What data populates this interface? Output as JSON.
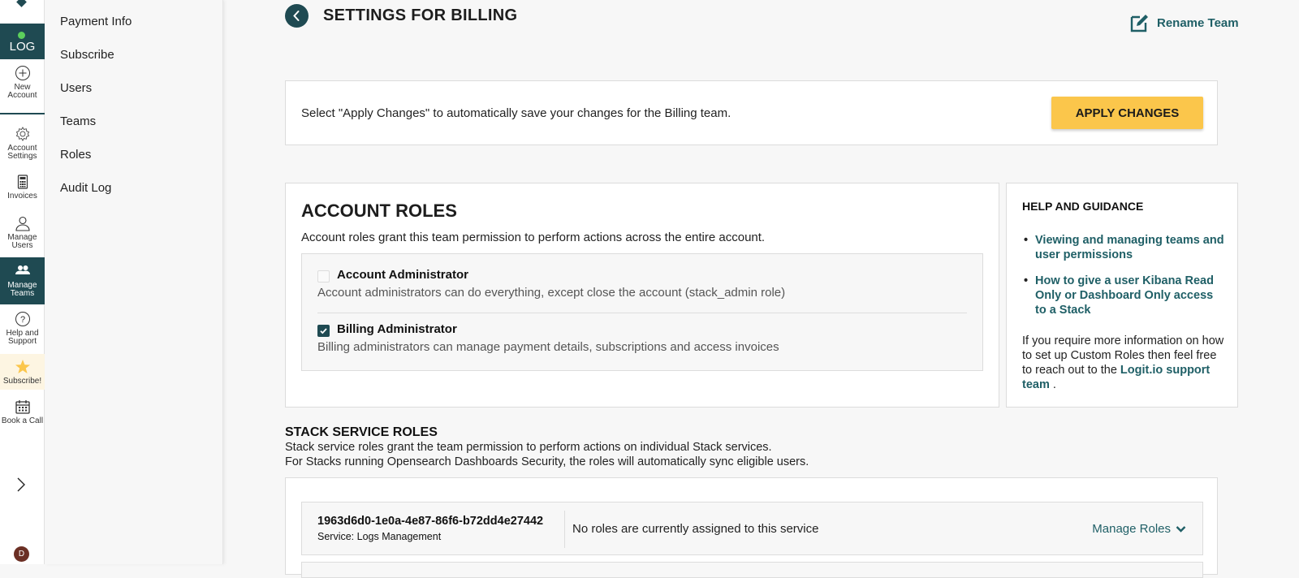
{
  "rail": {
    "brand_label": "LOG",
    "items": [
      {
        "label_l1": "New",
        "label_l2": "Account",
        "icon": "plus-circle-icon"
      },
      {
        "label_l1": "Account",
        "label_l2": "Settings",
        "icon": "gear-icon"
      },
      {
        "label_l1": "Invoices",
        "label_l2": "",
        "icon": "calculator-icon"
      },
      {
        "label_l1": "Manage",
        "label_l2": "Users",
        "icon": "user-icon"
      },
      {
        "label_l1": "Manage",
        "label_l2": "Teams",
        "icon": "users-icon"
      },
      {
        "label_l1": "Help and",
        "label_l2": "Support",
        "icon": "question-circle-icon"
      },
      {
        "label_l1": "Subscribe!",
        "label_l2": "",
        "icon": "star-icon"
      },
      {
        "label_l1": "Book a Call",
        "label_l2": "",
        "icon": "calendar-icon"
      }
    ],
    "avatar_initial": "D",
    "colors": {
      "brand": "#1f4a52",
      "status_dot": "#5ccf5c",
      "subscribe_bg": "#fdf5e2",
      "star": "#fbc64b"
    }
  },
  "subnav": {
    "items": [
      "Payment Info",
      "Subscribe",
      "Users",
      "Teams",
      "Roles",
      "Audit Log"
    ]
  },
  "header": {
    "title": "SETTINGS FOR BILLING",
    "rename_label": "Rename Team"
  },
  "apply": {
    "message": "Select \"Apply Changes\" to automatically save your changes for the Billing team.",
    "button_label": "APPLY CHANGES",
    "button_color": "#fbc64b"
  },
  "account_roles": {
    "title": "ACCOUNT ROLES",
    "description": "Account roles grant this team permission to perform actions across the entire account.",
    "roles": [
      {
        "name": "Account Administrator",
        "description": "Account administrators can do everything, except close the account (stack_admin role)",
        "checked": false
      },
      {
        "name": "Billing Administrator",
        "description": "Billing administrators can manage payment details, subscriptions and access invoices",
        "checked": true
      }
    ]
  },
  "help": {
    "title": "HELP AND GUIDANCE",
    "links": [
      "Viewing and managing teams and user permissions",
      "How to give a user Kibana Read Only or Dashboard Only access to a Stack"
    ],
    "more_text": "If you require more information on how to set up Custom Roles then feel free to reach out to the ",
    "more_link": "Logit.io support team",
    "more_suffix": " ."
  },
  "stack_roles": {
    "title": "STACK SERVICE ROLES",
    "description_l1": "Stack service roles grant the team permission to perform actions on individual Stack services.",
    "description_l2": "For Stacks running Opensearch Dashboards Security, the roles will automatically sync eligible users.",
    "services": [
      {
        "id": "1963d6d0-1e0a-4e87-86f6-b72dd4e27442",
        "type": "Service: Logs Management",
        "status": "No roles are currently assigned to this service",
        "action": "Manage Roles"
      }
    ]
  }
}
